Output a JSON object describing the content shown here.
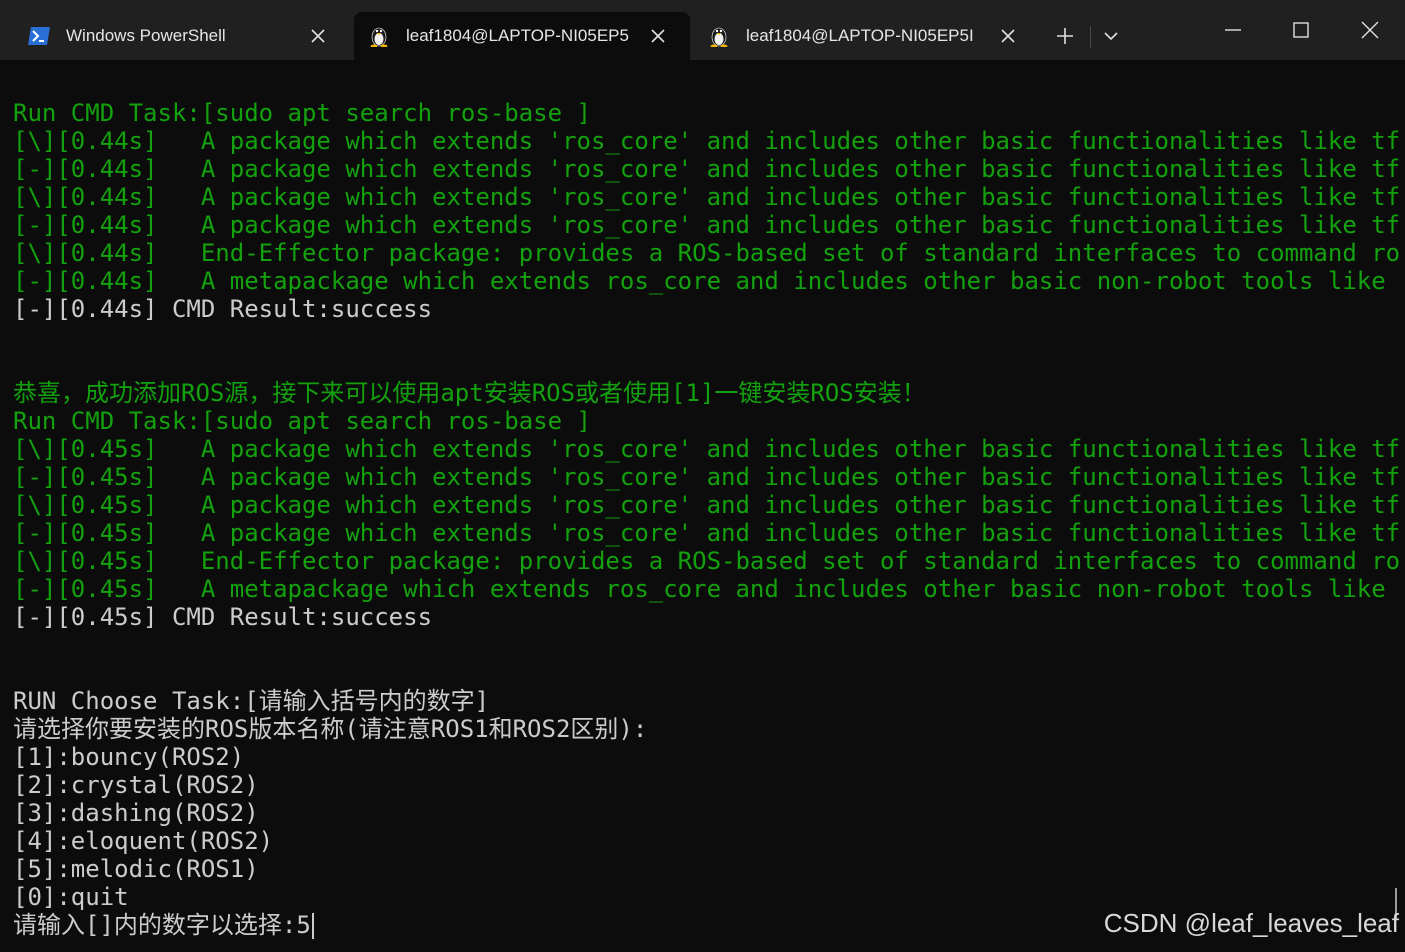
{
  "tabs": [
    {
      "title": "Windows PowerShell",
      "icon": "powershell-icon"
    },
    {
      "title": "leaf1804@LAPTOP-NI05EP5",
      "icon": "linux-penguin-icon"
    },
    {
      "title": "leaf1804@LAPTOP-NI05EP5I",
      "icon": "linux-penguin-icon"
    }
  ],
  "active_tab": 1,
  "icons": {
    "close": "close-icon",
    "new_tab": "plus-icon",
    "dropdown": "chevron-down-icon",
    "minimize": "minimize-icon",
    "maximize": "maximize-icon",
    "window_close": "window-close-icon"
  },
  "colors": {
    "terminal_bg": "#0c0c0c",
    "green": "#13a10e",
    "text": "#cccccc",
    "titlebar": "#202020"
  },
  "terminal": {
    "lines": [
      {
        "text": "Run CMD Task:[sudo apt search ros-base ]",
        "color": "green"
      },
      {
        "text": "[\\][0.44s]   A package which extends 'ros_core' and includes other basic functionalities like tf",
        "color": "green"
      },
      {
        "text": "[-][0.44s]   A package which extends 'ros_core' and includes other basic functionalities like tf",
        "color": "green"
      },
      {
        "text": "[\\][0.44s]   A package which extends 'ros_core' and includes other basic functionalities like tf",
        "color": "green"
      },
      {
        "text": "[-][0.44s]   A package which extends 'ros_core' and includes other basic functionalities like tf",
        "color": "green"
      },
      {
        "text": "[\\][0.44s]   End-Effector package: provides a ROS-based set of standard interfaces to command ro",
        "color": "green"
      },
      {
        "text": "[-][0.44s]   A metapackage which extends ros_core and includes other basic non-robot tools like",
        "color": "green"
      },
      {
        "text": "[-][0.44s] CMD Result:success",
        "color": "white"
      },
      {
        "text": "",
        "color": "white"
      },
      {
        "text": "",
        "color": "white"
      },
      {
        "text": "恭喜，成功添加ROS源，接下来可以使用apt安装ROS或者使用[1]一键安装ROS安装！",
        "color": "green"
      },
      {
        "text": "Run CMD Task:[sudo apt search ros-base ]",
        "color": "green"
      },
      {
        "text": "[\\][0.45s]   A package which extends 'ros_core' and includes other basic functionalities like tf",
        "color": "green"
      },
      {
        "text": "[-][0.45s]   A package which extends 'ros_core' and includes other basic functionalities like tf",
        "color": "green"
      },
      {
        "text": "[\\][0.45s]   A package which extends 'ros_core' and includes other basic functionalities like tf",
        "color": "green"
      },
      {
        "text": "[-][0.45s]   A package which extends 'ros_core' and includes other basic functionalities like tf",
        "color": "green"
      },
      {
        "text": "[\\][0.45s]   End-Effector package: provides a ROS-based set of standard interfaces to command ro",
        "color": "green"
      },
      {
        "text": "[-][0.45s]   A metapackage which extends ros_core and includes other basic non-robot tools like",
        "color": "green"
      },
      {
        "text": "[-][0.45s] CMD Result:success",
        "color": "white"
      },
      {
        "text": "",
        "color": "white"
      },
      {
        "text": "",
        "color": "white"
      },
      {
        "text": "RUN Choose Task:[请输入括号内的数字]",
        "color": "white"
      },
      {
        "text": "请选择你要安装的ROS版本名称(请注意ROS1和ROS2区别):",
        "color": "white"
      },
      {
        "text": "[1]:bouncy(ROS2)",
        "color": "white"
      },
      {
        "text": "[2]:crystal(ROS2)",
        "color": "white"
      },
      {
        "text": "[3]:dashing(ROS2)",
        "color": "white"
      },
      {
        "text": "[4]:eloquent(ROS2)",
        "color": "white"
      },
      {
        "text": "[5]:melodic(ROS1)",
        "color": "white"
      },
      {
        "text": "[0]:quit",
        "color": "white"
      }
    ],
    "prompt": "请输入[]内的数字以选择:",
    "input": "5"
  },
  "watermark": "CSDN @leaf_leaves_leaf"
}
